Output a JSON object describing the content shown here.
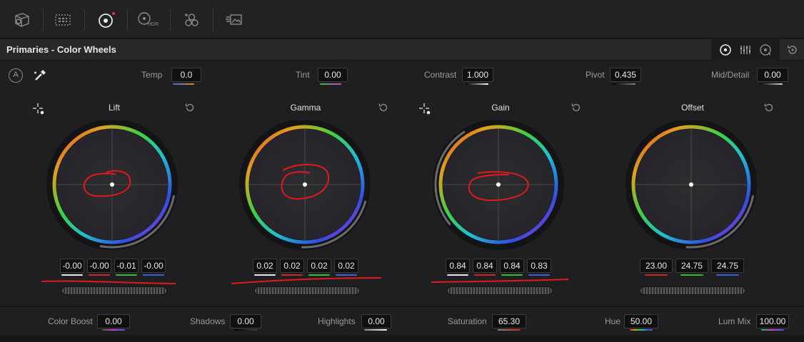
{
  "toolbar": {
    "icons": [
      "camera-raw-icon",
      "color-match-icon",
      "color-wheels-icon",
      "hdr-icon",
      "rgb-mixer-icon",
      "motion-effects-icon"
    ],
    "hdr_label": "HDR",
    "active_dot_color": "#e0304a"
  },
  "panel": {
    "title": "Primaries - Color Wheels"
  },
  "adjust": {
    "auto_label": "A",
    "temp": {
      "label": "Temp",
      "value": "0.0"
    },
    "tint": {
      "label": "Tint",
      "value": "0.00"
    },
    "contrast": {
      "label": "Contrast",
      "value": "1.000"
    },
    "pivot": {
      "label": "Pivot",
      "value": "0.435"
    },
    "mid_detail": {
      "label": "Mid/Detail",
      "value": "0.00"
    }
  },
  "wheels": [
    {
      "name": "Lift",
      "values": [
        "-0.00",
        "-0.00",
        "-0.01",
        "-0.00"
      ]
    },
    {
      "name": "Gamma",
      "values": [
        "0.02",
        "0.02",
        "0.02",
        "0.02"
      ]
    },
    {
      "name": "Gain",
      "values": [
        "0.84",
        "0.84",
        "0.84",
        "0.83"
      ]
    },
    {
      "name": "Offset",
      "values": [
        "23.00",
        "24.75",
        "24.75"
      ]
    }
  ],
  "bottom": {
    "color_boost": {
      "label": "Color Boost",
      "value": "0.00"
    },
    "shadows": {
      "label": "Shadows",
      "value": "0.00"
    },
    "highlights": {
      "label": "Highlights",
      "value": "0.00"
    },
    "saturation": {
      "label": "Saturation",
      "value": "65.30"
    },
    "hue": {
      "label": "Hue",
      "value": "50.00"
    },
    "lum_mix": {
      "label": "Lum Mix",
      "value": "100.00"
    }
  },
  "colors": {
    "annotation_red": "#e01a1a",
    "channel_white": "#e8e8e8",
    "channel_red": "#d02828",
    "channel_green": "#2fbf3a",
    "channel_blue": "#3a5fe0"
  }
}
